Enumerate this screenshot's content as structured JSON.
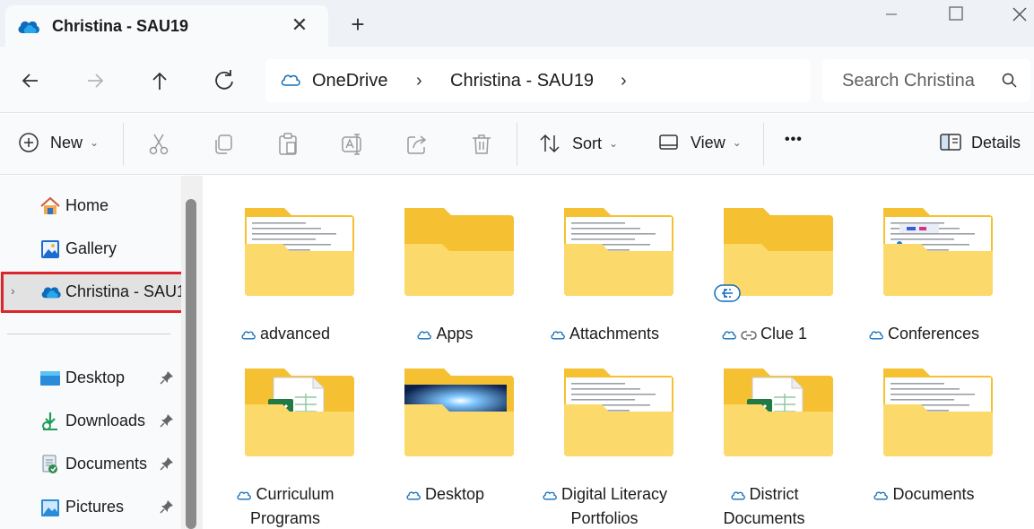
{
  "window": {
    "tab_title": "Christina - SAU19",
    "tab_close": "✕",
    "new_tab": "+"
  },
  "address_bar": {
    "breadcrumb": [
      "OneDrive",
      "Christina - SAU19"
    ],
    "chevron": "›",
    "search_placeholder": "Search Christina"
  },
  "toolbar": {
    "new_label": "New",
    "sort_label": "Sort",
    "view_label": "View",
    "more_label": "•••",
    "details_label": "Details",
    "chevron": "⌄"
  },
  "sidebar": {
    "items": [
      {
        "label": "Home",
        "icon": "home-icon"
      },
      {
        "label": "Gallery",
        "icon": "gallery-icon"
      },
      {
        "label": "Christina - SAU1",
        "icon": "onedrive-cloud-icon",
        "selected": true
      },
      {
        "label": "Desktop",
        "icon": "desktop-folder-icon",
        "pinned": true
      },
      {
        "label": "Downloads",
        "icon": "downloads-folder-icon",
        "pinned": true
      },
      {
        "label": "Documents",
        "icon": "documents-folder-icon",
        "pinned": true
      },
      {
        "label": "Pictures",
        "icon": "pictures-folder-icon",
        "pinned": true
      }
    ],
    "expander": "›",
    "pin": "📌"
  },
  "folders": [
    {
      "line1": "advanced",
      "line2": "",
      "preview": "text"
    },
    {
      "line1": "Apps",
      "line2": "",
      "preview": "none"
    },
    {
      "line1": "Attachments",
      "line2": "",
      "preview": "text"
    },
    {
      "line1": "Clue 1",
      "line2": "",
      "preview": "none",
      "shared": true
    },
    {
      "line1": "Conferences",
      "line2": "",
      "preview": "web"
    },
    {
      "line1": "Curriculum",
      "line2": "Programs",
      "preview": "excel"
    },
    {
      "line1": "Desktop",
      "line2": "",
      "preview": "image"
    },
    {
      "line1": "Digital Literacy",
      "line2": "Portfolios",
      "preview": "text"
    },
    {
      "line1": "District",
      "line2": "Documents",
      "preview": "excel"
    },
    {
      "line1": "Documents",
      "line2": "",
      "preview": "text"
    }
  ],
  "colors": {
    "folder_back": "#f5c032",
    "folder_front": "#fcd96b",
    "onedrive_blue": "#0f6cbd",
    "selection_outline": "#d9262c"
  }
}
